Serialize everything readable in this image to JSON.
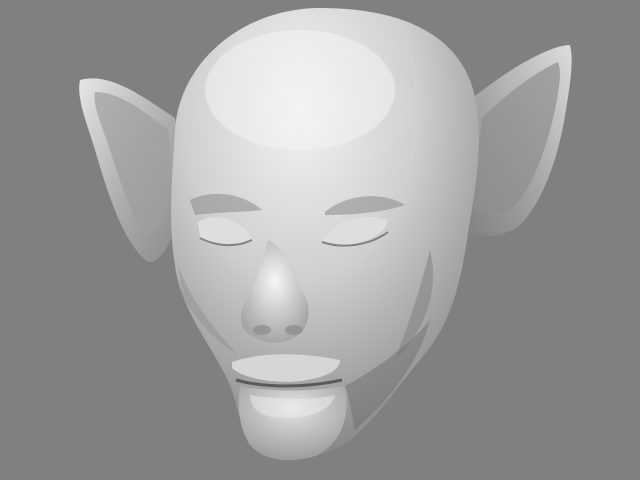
{
  "colors": {
    "background": "#808080",
    "model_light": "#f2f2f2",
    "model_mid": "#b8b8b8",
    "model_dark": "#6e6e6e",
    "model_shadow": "#5a5a5a"
  },
  "viewport": {
    "subject": "sculpted-creature-head-3d-render"
  }
}
